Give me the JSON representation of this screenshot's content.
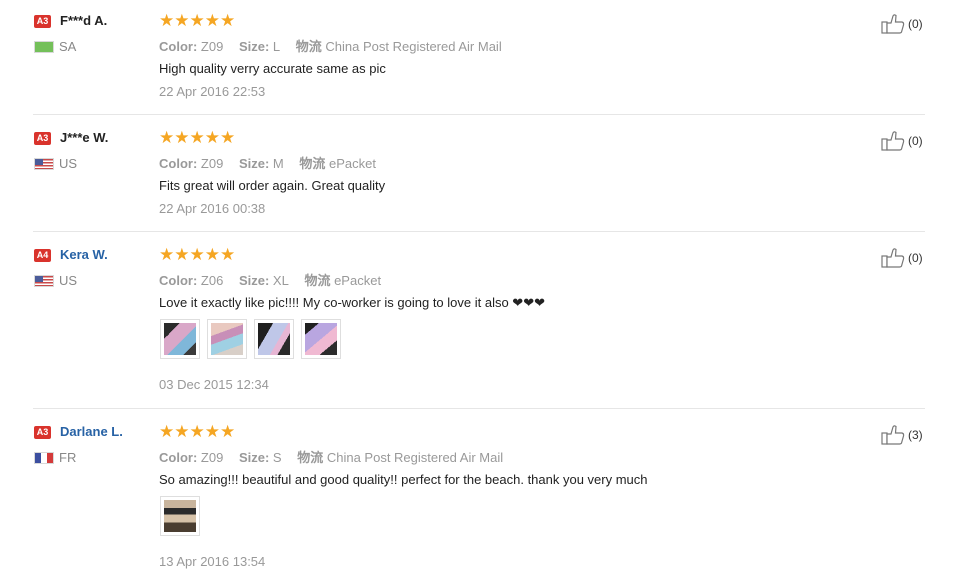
{
  "labels": {
    "color": "Color:",
    "size": "Size:",
    "shipping": "物流"
  },
  "reviews": [
    {
      "level": "A3",
      "name": "F***d A.",
      "country": "SA",
      "stars": "★★★★★",
      "color": "Z09",
      "size": "L",
      "shipping": "China Post Registered Air Mail",
      "feedback": "High quality verry accurate same as pic",
      "date": "22 Apr 2016 22:53",
      "helpful": "(0)"
    },
    {
      "level": "A3",
      "name": "J***e W.",
      "country": "US",
      "stars": "★★★★★",
      "color": "Z09",
      "size": "M",
      "shipping": "ePacket",
      "feedback": "Fits great will order again. Great quality",
      "date": "22 Apr 2016 00:38",
      "helpful": "(0)"
    },
    {
      "level": "A4",
      "name": "Kera W.",
      "country": "US",
      "stars": "★★★★★",
      "color": "Z06",
      "size": "XL",
      "shipping": "ePacket",
      "feedback": "Love it exactly like pic!!!! My co-worker is going to love it also ❤❤❤",
      "date": "03 Dec 2015 12:34",
      "helpful": "(0)",
      "photo_count": 4
    },
    {
      "level": "A3",
      "name": "Darlane L.",
      "country": "FR",
      "stars": "★★★★★",
      "color": "Z09",
      "size": "S",
      "shipping": "China Post Registered Air Mail",
      "feedback": "So amazing!!! beautiful and good quality!! perfect for the beach. thank you very much",
      "date": "13 Apr 2016 13:54",
      "helpful": "(3)",
      "photo_count": 1
    }
  ],
  "colors": {
    "star": "#f5a623",
    "level_badge": "#d9332c",
    "link_name": "#2762a5"
  }
}
